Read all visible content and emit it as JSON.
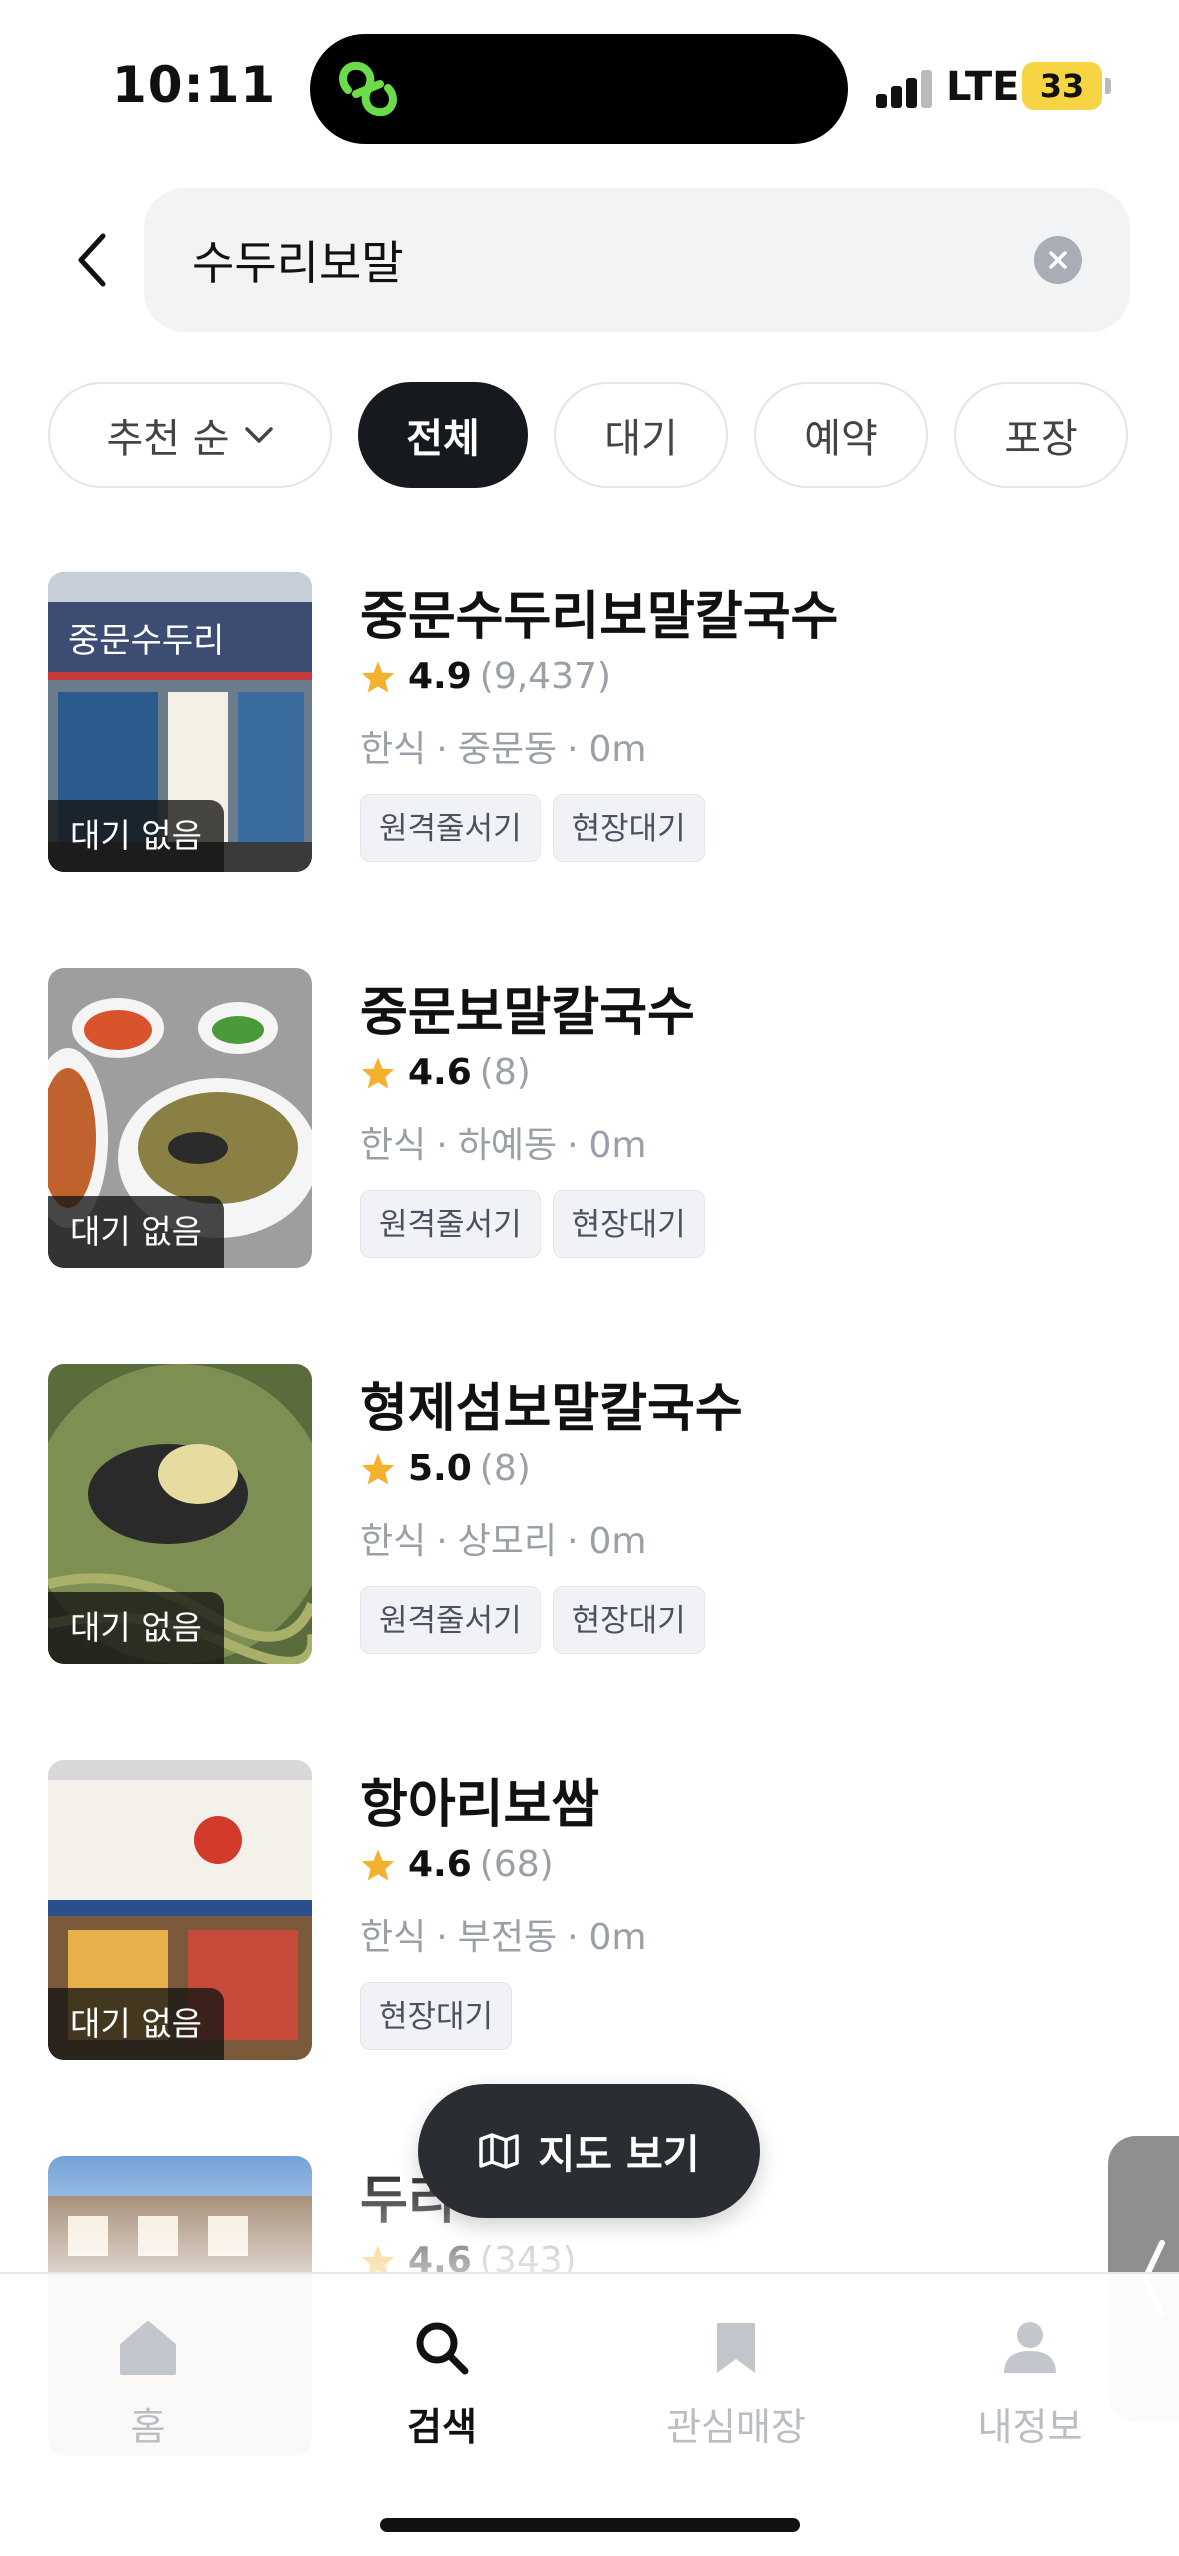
{
  "status_bar": {
    "time": "10:11",
    "network": "LTE",
    "battery": "33"
  },
  "search": {
    "query": "수두리보말",
    "icons": {
      "back": "chevron-left-icon",
      "clear": "clear-icon"
    }
  },
  "filters": {
    "sort_label": "추천 순",
    "chips": [
      {
        "label": "전체",
        "active": true
      },
      {
        "label": "대기",
        "active": false
      },
      {
        "label": "예약",
        "active": false
      },
      {
        "label": "포장",
        "active": false
      }
    ]
  },
  "results": [
    {
      "name": "중문수두리보말칼국수",
      "score": "4.9",
      "count": "(9,437)",
      "category": "한식",
      "area": "중문동",
      "distance": "0m",
      "badge": "대기 없음",
      "tags": [
        "원격줄서기",
        "현장대기"
      ],
      "thumb": "storefront"
    },
    {
      "name": "중문보말칼국수",
      "score": "4.6",
      "count": "(8)",
      "category": "한식",
      "area": "하예동",
      "distance": "0m",
      "badge": "대기 없음",
      "tags": [
        "원격줄서기",
        "현장대기"
      ],
      "thumb": "food"
    },
    {
      "name": "형제섬보말칼국수",
      "score": "5.0",
      "count": "(8)",
      "category": "한식",
      "area": "상모리",
      "distance": "0m",
      "badge": "대기 없음",
      "tags": [
        "원격줄서기",
        "현장대기"
      ],
      "thumb": "noodle"
    },
    {
      "name": "항아리보쌈",
      "score": "4.6",
      "count": "(68)",
      "category": "한식",
      "area": "부전동",
      "distance": "0m",
      "badge": "대기 없음",
      "tags": [
        "현장대기"
      ],
      "thumb": "sign"
    },
    {
      "name": "두리",
      "score": "4.6",
      "count": "(343)",
      "category": "",
      "area": "",
      "distance": "",
      "badge": "",
      "tags": [],
      "thumb": "building"
    }
  ],
  "map_button": {
    "label": "지도 보기",
    "icon": "map-icon"
  },
  "bottom_nav": [
    {
      "label": "홈",
      "icon": "home-icon",
      "active": false
    },
    {
      "label": "검색",
      "icon": "search-icon",
      "active": true
    },
    {
      "label": "관심매장",
      "icon": "bookmark-icon",
      "active": false
    },
    {
      "label": "내정보",
      "icon": "user-icon",
      "active": false
    }
  ],
  "colors": {
    "star": "#f4b12f",
    "active_chip": "#161a1f",
    "muted_text": "#9aa0a8",
    "tag_bg": "#f0f2f5"
  }
}
